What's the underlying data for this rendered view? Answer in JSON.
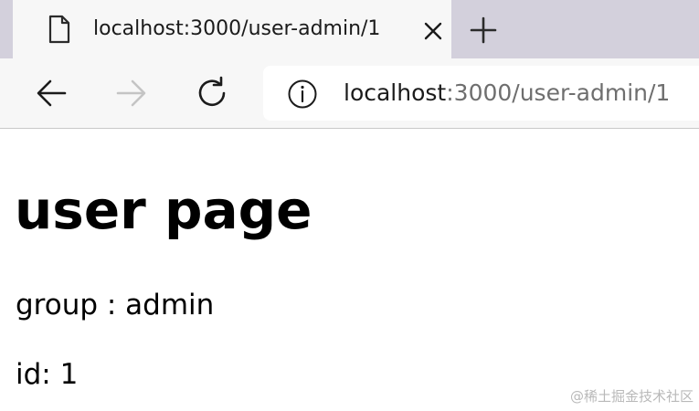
{
  "browser": {
    "tab": {
      "title": "localhost:3000/user-admin/1",
      "icon": "file-icon",
      "close_icon": "close-icon"
    },
    "new_tab_icon": "plus-icon",
    "toolbar": {
      "back_icon": "back-arrow-icon",
      "forward_icon": "forward-arrow-icon",
      "reload_icon": "reload-icon",
      "forward_enabled": false
    },
    "address_bar": {
      "info_icon": "info-icon",
      "url_host": "localhost",
      "url_rest": ":3000/user-admin/1"
    }
  },
  "page": {
    "heading": "user page",
    "group_line": "group : admin",
    "id_line": "id: 1"
  },
  "watermark": "@稀土掘金技术社区",
  "colors": {
    "tabstrip_bg": "#d3d0dc",
    "toolbar_bg": "#f7f7f7",
    "url_host": "#1b1b1b",
    "url_rest": "#6e6e6e",
    "disabled_icon": "#c4c4c4"
  }
}
